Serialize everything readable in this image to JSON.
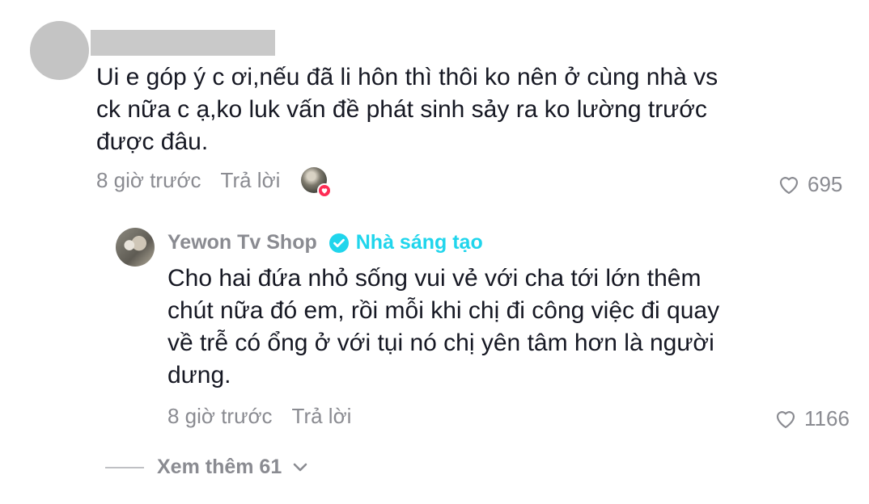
{
  "comment": {
    "text": "Ui e góp ý c ơi,nếu đã li hôn thì thôi ko nên ở cùng nhà vs\nck nữa c ạ,ko luk vấn đề phát sinh sảy ra ko lường trước\nđược đâu.",
    "time": "8 giờ trước",
    "reply_label": "Trả lời",
    "likes": "695"
  },
  "reply": {
    "author": "Yewon Tv Shop",
    "badge": "Nhà sáng tạo",
    "text": "Cho hai đứa nhỏ sống vui vẻ với cha tới lớn thêm\nchút nữa đó em, rồi mỗi khi chị đi công việc đi quay\nvề trễ có ổng ở với tụi nó chị yên tâm hơn là người\ndưng.",
    "time": "8 giờ trước",
    "reply_label": "Trả lời",
    "likes": "1166"
  },
  "more": {
    "label": "Xem thêm 61"
  },
  "colors": {
    "text": "#161823",
    "muted": "#8a8b91",
    "creator": "#20d5ec",
    "like_badge": "#fe2c55"
  }
}
